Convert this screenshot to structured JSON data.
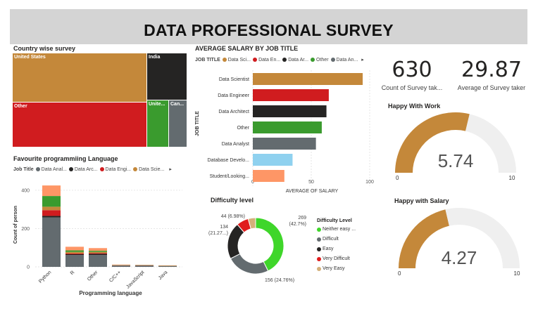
{
  "header": {
    "title": "DATA PROFESSIONAL SURVEY"
  },
  "treemap": {
    "title": "Country wise survey",
    "cells": [
      {
        "label": "United States",
        "color": "#c4883a"
      },
      {
        "label": "India",
        "color": "#252423"
      },
      {
        "label": "Other",
        "color": "#d01c1f"
      },
      {
        "label": "Unite...",
        "color": "#3a9b2e"
      },
      {
        "label": "Can...",
        "color": "#636b6f"
      }
    ]
  },
  "salary_chart": {
    "title": "AVERAGE SALARY BY JOB TITLE",
    "legend_title": "JOB TITLE",
    "legend": [
      {
        "label": "Data Sci...",
        "color": "#c4883a"
      },
      {
        "label": "Data En...",
        "color": "#d01c1f"
      },
      {
        "label": "Data Ar...",
        "color": "#252423"
      },
      {
        "label": "Other",
        "color": "#3a9b2e"
      },
      {
        "label": "Data An...",
        "color": "#636b6f"
      }
    ],
    "xlabel": "AVERAGE OF SALARY",
    "ylabel": "JOB TITLE",
    "ticks": [
      "0",
      "50",
      "100"
    ]
  },
  "lang_chart": {
    "title": "Favourite programmiing Language",
    "legend_title": "Job Title",
    "legend": [
      {
        "label": "Data Anal...",
        "color": "#636b6f"
      },
      {
        "label": "Data Arc...",
        "color": "#252423"
      },
      {
        "label": "Data Engi...",
        "color": "#d01c1f"
      },
      {
        "label": "Data Scie...",
        "color": "#c4883a"
      }
    ],
    "xlabel": "Programming language",
    "ylabel": "Count of person",
    "ticks": [
      "0",
      "200",
      "400"
    ]
  },
  "difficulty": {
    "title": "Difficulty level",
    "legend_title": "Difficulty Level",
    "legend": [
      {
        "label": "Neither easy ...",
        "color": "#3fd62a"
      },
      {
        "label": "Difficult",
        "color": "#636b6f"
      },
      {
        "label": "Easy",
        "color": "#252423"
      },
      {
        "label": "Very Difficult",
        "color": "#e01d1d"
      },
      {
        "label": "Very Easy",
        "color": "#d4b07a"
      }
    ],
    "labels": {
      "neither_1": "269",
      "neither_2": "(42.7%)",
      "difficult": "156 (24.76%)",
      "easy_1": "134",
      "easy_2": "(21.27...)",
      "very_diff": "44 (6.98%)"
    }
  },
  "cards": {
    "count": {
      "value": "630",
      "label": "Count of Survey tak..."
    },
    "age": {
      "value": "29.87",
      "label": "Average of Survey taker"
    }
  },
  "gauges": {
    "work": {
      "title": "Happy With Work",
      "value_text": "5.74",
      "value": 5.74,
      "min_label": "0",
      "max_label": "10",
      "min": 0,
      "max": 10
    },
    "salary": {
      "title": "Happy with Salary",
      "value_text": "4.27",
      "value": 4.27,
      "min_label": "0",
      "max_label": "10",
      "min": 0,
      "max": 10
    }
  },
  "colors": {
    "accent": "#c4883a",
    "track": "#efefef"
  },
  "chart_data": [
    {
      "type": "bar",
      "title": "AVERAGE SALARY BY JOB TITLE",
      "orientation": "horizontal",
      "categories": [
        "Data Scientist",
        "Data Engineer",
        "Data Architect",
        "Other",
        "Data Analyst",
        "Database Develo...",
        "Student/Looking..."
      ],
      "values": [
        94,
        65,
        63,
        59,
        54,
        34,
        27
      ],
      "colors": [
        "#c4883a",
        "#d01c1f",
        "#252423",
        "#3a9b2e",
        "#636b6f",
        "#8fd1ef",
        "#fe9666"
      ],
      "xlabel": "AVERAGE OF SALARY",
      "ylabel": "JOB TITLE",
      "xlim": [
        0,
        100
      ]
    },
    {
      "type": "bar",
      "stacked": true,
      "title": "Favourite programmiing Language",
      "categories": [
        "Python",
        "R",
        "Other",
        "C/C++",
        "JavaScript",
        "Java"
      ],
      "series": [
        {
          "name": "Data Anal...",
          "color": "#636b6f",
          "values": [
            258,
            62,
            62,
            6,
            6,
            4
          ]
        },
        {
          "name": "Data Arc...",
          "color": "#252423",
          "values": [
            8,
            4,
            6,
            1,
            1,
            0
          ]
        },
        {
          "name": "Data Engi...",
          "color": "#d01c1f",
          "values": [
            30,
            4,
            4,
            1,
            1,
            1
          ]
        },
        {
          "name": "Data Scie...",
          "color": "#c4883a",
          "values": [
            18,
            8,
            6,
            1,
            1,
            1
          ]
        },
        {
          "name": "",
          "color": "#3a9b2e",
          "values": [
            56,
            8,
            6,
            1,
            1,
            1
          ]
        },
        {
          "name": "",
          "color": "#fe9666",
          "values": [
            55,
            19,
            14,
            2,
            1,
            1
          ]
        }
      ],
      "xlabel": "Programming language",
      "ylabel": "Count of person",
      "ylim": [
        0,
        440
      ]
    },
    {
      "type": "pie",
      "donut": true,
      "title": "Difficulty level",
      "categories": [
        "Neither easy ...",
        "Difficult",
        "Easy",
        "Very Difficult",
        "Very Easy"
      ],
      "values": [
        269,
        156,
        134,
        44,
        27
      ],
      "colors": [
        "#3fd62a",
        "#636b6f",
        "#252423",
        "#e01d1d",
        "#d4b07a"
      ]
    }
  ]
}
